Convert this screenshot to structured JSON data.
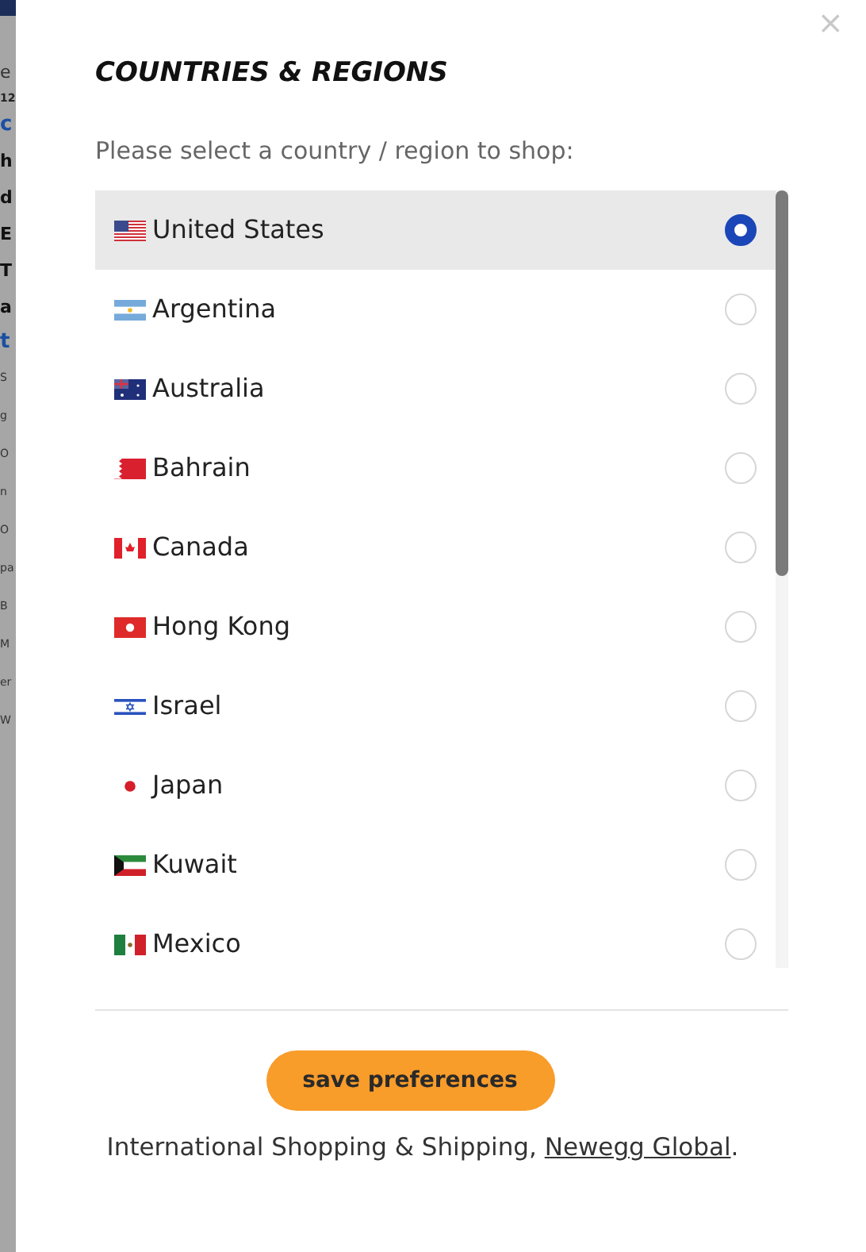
{
  "background_page": {
    "fragments": [
      {
        "text": "e",
        "kind": "nav"
      },
      {
        "text": "12",
        "kind": "bold"
      },
      {
        "text": "c",
        "kind": "link"
      },
      {
        "text": "h",
        "kind": "heading"
      },
      {
        "text": "d",
        "kind": "heading"
      },
      {
        "text": "E",
        "kind": "heading"
      },
      {
        "text": "T",
        "kind": "heading"
      },
      {
        "text": "a",
        "kind": "heading"
      },
      {
        "text": "t",
        "kind": "link"
      },
      {
        "text": "S",
        "kind": "small"
      },
      {
        "text": "g",
        "kind": "small"
      },
      {
        "text": "O",
        "kind": "small"
      },
      {
        "text": "n",
        "kind": "small"
      },
      {
        "text": "O",
        "kind": "small"
      },
      {
        "text": "pa",
        "kind": "small"
      },
      {
        "text": "B",
        "kind": "small"
      },
      {
        "text": "M",
        "kind": "small"
      },
      {
        "text": "er",
        "kind": "small"
      },
      {
        "text": "W",
        "kind": "small"
      }
    ]
  },
  "dialog": {
    "close": "×",
    "title": "COUNTRIES & REGIONS",
    "prompt": "Please select a country / region to shop:",
    "countries": [
      {
        "name": "United States",
        "selected": true
      },
      {
        "name": "Argentina",
        "selected": false
      },
      {
        "name": "Australia",
        "selected": false
      },
      {
        "name": "Bahrain",
        "selected": false
      },
      {
        "name": "Canada",
        "selected": false
      },
      {
        "name": "Hong Kong",
        "selected": false
      },
      {
        "name": "Israel",
        "selected": false
      },
      {
        "name": "Japan",
        "selected": false
      },
      {
        "name": "Kuwait",
        "selected": false
      },
      {
        "name": "Mexico",
        "selected": false
      }
    ],
    "save_button": "save preferences",
    "footer": {
      "text": "International Shopping & Shipping, ",
      "link": "Newegg Global",
      "end": "."
    }
  }
}
